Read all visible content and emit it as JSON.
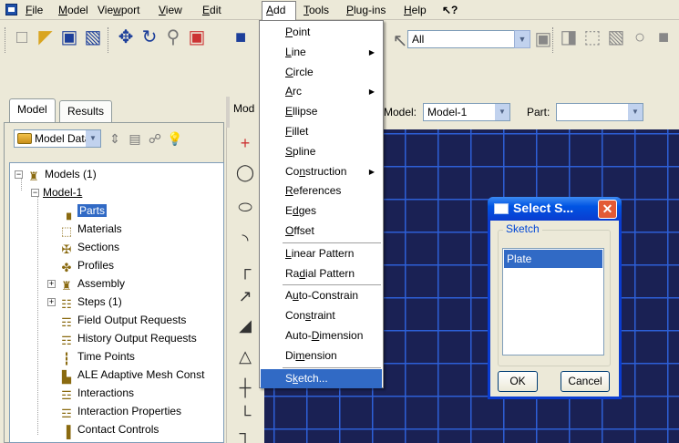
{
  "menubar": {
    "items": [
      "File",
      "Model",
      "Viewport",
      "View",
      "Edit",
      "Add",
      "Tools",
      "Plug-ins",
      "Help"
    ],
    "underline": [
      "F",
      "M",
      "w",
      "V",
      "E",
      "A",
      "T",
      "P",
      "H"
    ],
    "whats_this": "↖?"
  },
  "toolbar": {
    "selection_filter": "All"
  },
  "left_panel": {
    "tabs": [
      "Model",
      "Results"
    ],
    "model_data_select": "Model Data",
    "tree": [
      {
        "label": "Models (1)",
        "expander": "−",
        "icon": "models-icon",
        "glyph": "♜"
      },
      {
        "label": "Model-1",
        "expander": "−",
        "icon": "",
        "glyph": ""
      },
      {
        "label": "Parts",
        "expander": "",
        "icon": "parts-icon",
        "glyph": "▗"
      },
      {
        "label": "Materials",
        "expander": "",
        "icon": "materials-icon",
        "glyph": "⬚"
      },
      {
        "label": "Sections",
        "expander": "",
        "icon": "sections-icon",
        "glyph": "✠"
      },
      {
        "label": "Profiles",
        "expander": "",
        "icon": "profiles-icon",
        "glyph": "✤"
      },
      {
        "label": "Assembly",
        "expander": "+",
        "icon": "assembly-icon",
        "glyph": "♜"
      },
      {
        "label": "Steps (1)",
        "expander": "+",
        "icon": "steps-icon",
        "glyph": "☷"
      },
      {
        "label": "Field Output Requests",
        "expander": "",
        "icon": "field-output-icon",
        "glyph": "☶"
      },
      {
        "label": "History Output Requests",
        "expander": "",
        "icon": "history-output-icon",
        "glyph": "☶"
      },
      {
        "label": "Time Points",
        "expander": "",
        "icon": "time-points-icon",
        "glyph": "┇"
      },
      {
        "label": "ALE Adaptive Mesh Const",
        "expander": "",
        "icon": "ale-mesh-icon",
        "glyph": "▙"
      },
      {
        "label": "Interactions",
        "expander": "",
        "icon": "interactions-icon",
        "glyph": "☲"
      },
      {
        "label": "Interaction Properties",
        "expander": "",
        "icon": "interaction-properties-icon",
        "glyph": "☲"
      },
      {
        "label": "Contact Controls",
        "expander": "",
        "icon": "contact-controls-icon",
        "glyph": "▐"
      }
    ]
  },
  "module_tab": "Mod",
  "context_bar": {
    "model_label": "Model:",
    "model_value": "Model-1",
    "part_label": "Part:",
    "part_value": ""
  },
  "add_menu": {
    "items": [
      {
        "label": "Point",
        "u": "P",
        "submenu": false
      },
      {
        "label": "Line",
        "u": "L",
        "submenu": true
      },
      {
        "label": "Circle",
        "u": "C",
        "submenu": false
      },
      {
        "label": "Arc",
        "u": "A",
        "submenu": true
      },
      {
        "label": "Ellipse",
        "u": "E",
        "submenu": false
      },
      {
        "label": "Fillet",
        "u": "F",
        "submenu": false
      },
      {
        "label": "Spline",
        "u": "S",
        "submenu": false
      },
      {
        "label": "Construction",
        "u": "n",
        "submenu": true
      },
      {
        "label": "References",
        "u": "R",
        "submenu": false
      },
      {
        "label": "Edges",
        "u": "d",
        "submenu": false
      },
      {
        "label": "Offset",
        "u": "O",
        "submenu": false
      },
      {
        "label": "Linear Pattern",
        "u": "L",
        "submenu": false
      },
      {
        "label": "Radial Pattern",
        "u": "d",
        "submenu": false
      },
      {
        "label": "Auto-Constrain",
        "u": "u",
        "submenu": false
      },
      {
        "label": "Constraint",
        "u": "s",
        "submenu": false
      },
      {
        "label": "Auto-Dimension",
        "u": "D",
        "submenu": false
      },
      {
        "label": "Dimension",
        "u": "m",
        "submenu": false
      },
      {
        "label": "Sketch...",
        "u": "k",
        "submenu": false
      }
    ],
    "highlighted": "Sketch..."
  },
  "dialog": {
    "title": "Select S...",
    "group_label": "Sketch",
    "items": [
      "Plate"
    ],
    "ok_label": "OK",
    "cancel_label": "Cancel"
  },
  "colors": {
    "viewport_bg": "#1a2154",
    "grid": "#2d5fd6",
    "selection": "#316ac5",
    "xp_title": "#0054e3"
  }
}
